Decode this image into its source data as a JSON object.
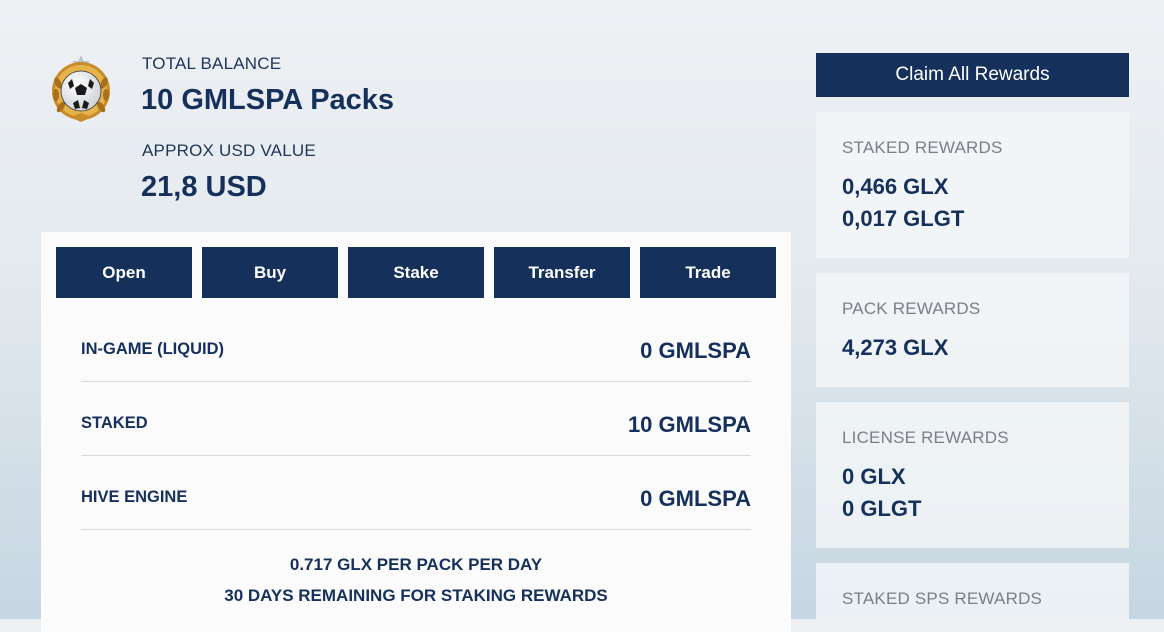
{
  "balance": {
    "total_label": "TOTAL BALANCE",
    "total_value": "10 GMLSPA Packs",
    "usd_label": "APPROX USD VALUE",
    "usd_value": "21,8 USD"
  },
  "emblem": {
    "icon": "soccer-ball-laurel-icon"
  },
  "actions": [
    "Open",
    "Buy",
    "Stake",
    "Transfer",
    "Trade"
  ],
  "holdings": [
    {
      "label": "IN-GAME (LIQUID)",
      "value": "0 GMLSPA"
    },
    {
      "label": "STAKED",
      "value": "10 GMLSPA"
    },
    {
      "label": "HIVE ENGINE",
      "value": "0 GMLSPA"
    }
  ],
  "staking_info": {
    "rate": "0.717 GLX PER PACK PER DAY",
    "remaining": "30 DAYS REMAINING FOR STAKING REWARDS"
  },
  "rewards": {
    "claim_label": "Claim All Rewards",
    "staked": {
      "title": "STAKED REWARDS",
      "lines": [
        "0,466 GLX",
        "0,017 GLGT"
      ]
    },
    "pack": {
      "title": "PACK REWARDS",
      "lines": [
        "4,273 GLX"
      ]
    },
    "license": {
      "title": "LICENSE REWARDS",
      "lines": [
        "0 GLX",
        "0 GLGT"
      ]
    },
    "staked_sps": {
      "title": "STAKED SPS REWARDS",
      "lines": []
    }
  },
  "colors": {
    "primary": "#14305b",
    "muted": "#7a7f86",
    "panel": "#fbfbfb"
  }
}
